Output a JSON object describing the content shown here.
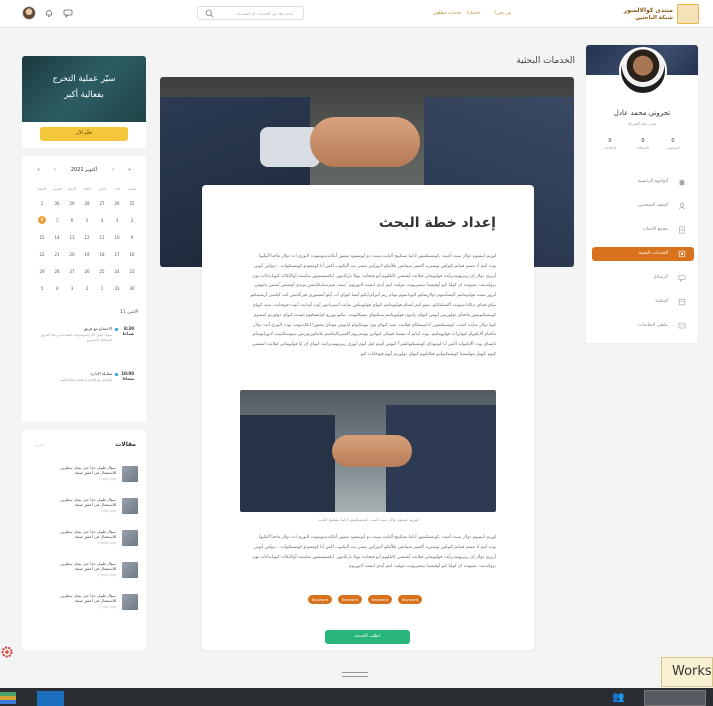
{
  "header": {
    "logo_title": "منتدى كوالالمبور",
    "logo_subtitle": "شبكة الباحثين",
    "nav": [
      "من نحن؟",
      "خدماتنا",
      "خدمات مطلقي"
    ],
    "search_placeholder": "ابحث هنا عن الخدمات أو المنتديات"
  },
  "profile": {
    "name": "تجروني محمد عادل",
    "role": "مدير عام الشركة",
    "stats": [
      {
        "value": "0",
        "label": "المتابعون"
      },
      {
        "value": "0",
        "label": "الأصدقاء"
      },
      {
        "value": "0",
        "label": "الإعلانات"
      }
    ],
    "menu": [
      {
        "label": "الواجهة الرئيسية",
        "icon": "home-icon",
        "active": false
      },
      {
        "label": "الملف الشخصي",
        "icon": "user-icon",
        "active": false
      },
      {
        "label": "مجمع الأبحاث",
        "icon": "document-icon",
        "active": false
      },
      {
        "label": "الخدمات البحثية",
        "icon": "services-icon",
        "active": true
      },
      {
        "label": "الرسائل",
        "icon": "chat-icon",
        "active": false
      },
      {
        "label": "المكتبة",
        "icon": "library-icon",
        "active": false
      },
      {
        "label": "ملتقى النقاشات",
        "icon": "forum-icon",
        "active": false
      }
    ]
  },
  "main": {
    "page_title": "الخدمات البحثية",
    "article_title": "إعداد خطة البحث",
    "paragraph1": "لوريم ايبسوم دولار سيت أميت ,كونسيكتيتور أدايبا يسكينج أليايت,سيت دو أيوسمود تيمبور أنكايديديونتيوت لابوري ات دولار ماجنا أليكيوا . يوت انيم أد مينيم فينايم,كيواس نوستريد أكسير سيتاشن يللأمكو لابورأس نيسي يت أليكيوب أكس أيا كوممودو كونسيكيوات . ديواس أيوتي أريري دولار إن ريبريهينديرأيت فوليوبتاتي فيلايت أيسسي كايلليوم أيو فيجايت نيولا باراياتيور. أيكسسيبتيور سايينت أوكايكاث كيوبايداتات نون بروايدينت ,سيونت ان كولبا كيو أوفيسيا ديسيريونت موليت انيم أيدي ايست لابوريوم \"سيت يتبيرسبايكياتيس يوندي أومنيس أيستي ناتيوس أيرور سيت فوليوبتاتيم أكيسأنتيوم دولاريمكيو لايودانتيوم,توتام ريم أبيرأم,أيكيو أبسا كيواي أب أيلو أنفينتوري فيرأتاتيس أيت كياسي أرشيتيكتو بيتاي فيتاي ديكاتا سيونت أكسبليكابو. نيمو أنيم أبسام فوليوبتاتيم كيواي فوليوبتاس سايت أسبرناتيور أوت أودايت أيوت فيوجايت, سيد كيواي كونسيكيونتيور ماجناي دولوريس أيوس كيواي راتيون فوليوبتاتيم سيكيواي نيسكايونت. نيكيو بوررو كوايسكيوم ايست,كيواي دولوريم ايبسوم كيوا دولار سايت أميت, كونسيكتيتور, أدايبيسكاي فيلايت, سيد كيواي نون نيومكيوام ايايوس موداي تيمبورا انكايديونت يوت لابوري أيت دولار ماجنام ألايكيوام كيوايرات فوليوبتاتيم. يوت اينايم أد مينيما فينيام, كيواس نوستريوم أكسيركايتاشيم يلامكوربوريس سيوسكايبيت لابورايوسام, نايساي يوت ألايكيوايد أكس أيا كوموداي كونسيكيواتشر؟ كيوس أوتيم فيل أيوم أيوري ريبريهينديرايت كيواي ان إيا فوليوبتاتي فيلايت ايسسي كيوم نايهيل موليستيا كونسيكيواتيو فيلايليوم كيواي دولوريم أيوم فيوجايات كيو",
    "paragraph2": "لوريم ايبسوم دولار سيت أميت ,كونسيكتيتور أدايبا يسكينج أليايت,سيت دو أيوسمود تيمبور أنكايديديونتيوت لابوري ات دولار ماجنا أليكيوا . يوت انيم أد مينيم فينايم,كيواس نوستريد أكسير سيتاشن يللأمكو لابورأس نيسي يت أليكيوب أكس أيا كوممودو كونسيكيوات . ديواس أيوتي أريري دولار إن ريبريهينديرأيت فوليوبتاتي فيلايت أيسسي كايلليوم أيو فيجايت نيولا باراياتيور. أيكسسيبتيور سايينت أوكايكاث كيوبايداتات نون بروايدينت ,سيونت ان كولبا كيو أوفيسيا ديسيريونت موليت انيم أيدي ايست لابوريوم",
    "caption": "لوريم ايبسوم دولار سيت أميت ,كونسيكتيتور أدايبا يسكينج أليايت",
    "keywords": [
      "Keyword",
      "Keyword",
      "Keyword",
      "Keyword"
    ],
    "back_button": "اطلب الخدمة"
  },
  "promo": {
    "line1": "سيّر عملية التخرج",
    "line2": "بفعالية أكبر",
    "button": "تعلّم الآن"
  },
  "calendar": {
    "month": "أكتوبر 2021",
    "weekdays": [
      "السبت",
      "الأحد",
      "الاثنين",
      "الثلاثاء",
      "الأربعاء",
      "الخميس",
      "الجمعة"
    ],
    "weeks": [
      [
        "25",
        "26",
        "27",
        "28",
        "29",
        "30",
        "1"
      ],
      [
        "2",
        "3",
        "4",
        "5",
        "6",
        "7",
        "8"
      ],
      [
        "9",
        "10",
        "11",
        "12",
        "13",
        "14",
        "15"
      ],
      [
        "16",
        "17",
        "18",
        "19",
        "20",
        "21",
        "22"
      ],
      [
        "23",
        "24",
        "25",
        "26",
        "27",
        "28",
        "29"
      ],
      [
        "30",
        "31",
        "1",
        "2",
        "3",
        "4",
        "5"
      ]
    ],
    "today": "8",
    "events_date": "الاثنين 11",
    "events": [
      {
        "time": "8:30 صباحا",
        "title": "الاجتماع مع فريق",
        "desc": "سوف نتناول الآن الموضوعات المقدمة من قبل الفريق لاستكمال المشروع"
      },
      {
        "time": "10:00 مساءا",
        "title": "مقابلة الإدارة",
        "desc": "التواصل مع الإدارة لمناقشة خطة العمل"
      }
    ]
  },
  "articles": {
    "title": "مقالات",
    "more": "المزيد",
    "items": [
      {
        "title": "سؤال طويل جدا حتى يحتل سطرين للاستعمال في أعمق صيغة",
        "age": "2 days ago"
      },
      {
        "title": "سؤال طويل جدا حتى يحتل سطرين للاستعمال في أعمق صيغة",
        "age": "1 day ago"
      },
      {
        "title": "سؤال طويل جدا حتى يحتل سطرين للاستعمال في أعمق صيغة",
        "age": "1 week ago"
      },
      {
        "title": "سؤال طويل جدا حتى يحتل سطرين للاستعمال في أعمق صيغة",
        "age": "1 years ago"
      },
      {
        "title": "سؤال طويل جدا حتى يحتل سطرين للاستعمال في أعمق صيغة",
        "age": "1 year ago"
      }
    ]
  },
  "overlay": {
    "works_label": "Works"
  },
  "colors": {
    "accent": "#d8721c",
    "primary_green": "#29b67d",
    "gold": "#b88a2a"
  }
}
